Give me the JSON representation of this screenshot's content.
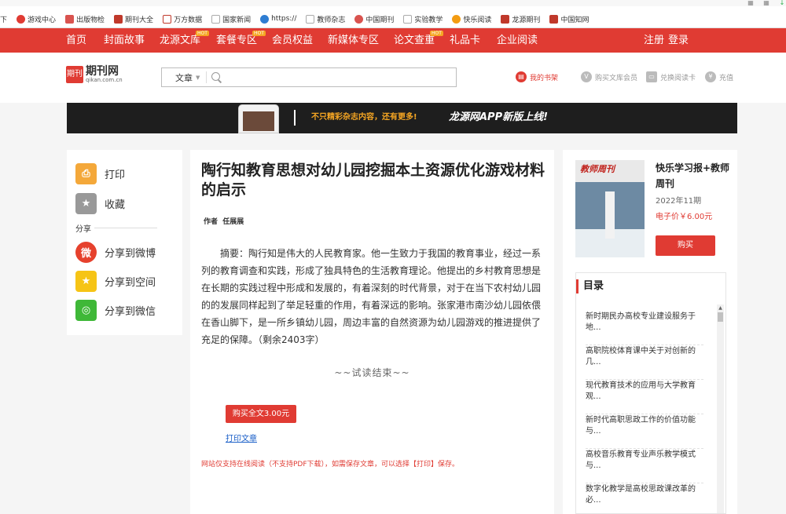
{
  "bookmarks": {
    "leading_text": "下",
    "items": [
      {
        "label": "游戏中心",
        "icon": "game-icon",
        "color": "#e03b33"
      },
      {
        "label": "出版物检",
        "icon": "pub-icon",
        "color": "#d9534f"
      },
      {
        "label": "期刊大全",
        "icon": "mag-icon",
        "color": "#c0392b"
      },
      {
        "label": "万方数据",
        "icon": "wanfang-icon",
        "color": "#c0392b"
      },
      {
        "label": "国家新闻",
        "icon": "doc-icon",
        "color": "#aaaaaa"
      },
      {
        "label": "https://",
        "icon": "globe-icon",
        "color": "#2e7dd2"
      },
      {
        "label": "教师杂志",
        "icon": "doc-icon",
        "color": "#aaaaaa"
      },
      {
        "label": "中国期刊",
        "icon": "cn-icon",
        "color": "#d9534f"
      },
      {
        "label": "实验教学",
        "icon": "doc-icon",
        "color": "#aaaaaa"
      },
      {
        "label": "快乐阅读",
        "icon": "happy-icon",
        "color": "#f39c12"
      },
      {
        "label": "龙源期刊",
        "icon": "longyuan-icon",
        "color": "#c0392b"
      },
      {
        "label": "中国知网",
        "icon": "cnki-icon",
        "color": "#c0392b"
      }
    ]
  },
  "nav": {
    "items": [
      {
        "label": "首页",
        "hot": false
      },
      {
        "label": "封面故事",
        "hot": false
      },
      {
        "label": "龙源文库",
        "hot": true
      },
      {
        "label": "套餐专区",
        "hot": true
      },
      {
        "label": "会员权益",
        "hot": false
      },
      {
        "label": "新媒体专区",
        "hot": false
      },
      {
        "label": "论文查重",
        "hot": true
      },
      {
        "label": "礼品卡",
        "hot": false
      },
      {
        "label": "企业阅读",
        "hot": false
      }
    ],
    "hot_badge": "HOT",
    "register": "注册",
    "login": "登录"
  },
  "header": {
    "logo_mark": "期刊",
    "logo_name": "期刊网",
    "logo_url": "qikan.com.cn",
    "search_category": "文章",
    "search_placeholder": "",
    "my_shelf": "我的书架",
    "buy_member": "购买文库会员",
    "exchange_card": "兑换阅读卡",
    "recharge": "充值"
  },
  "banner": {
    "text1": "不只精彩杂志内容，还有更多!",
    "text2": "龙源网APP新版上线!"
  },
  "share": {
    "print": "打印",
    "favorite": "收藏",
    "section": "分享",
    "weibo": "分享到微博",
    "qzone": "分享到空间",
    "wechat": "分享到微信"
  },
  "article": {
    "title": "陶行知教育思想对幼儿园挖掘本土资源优化游戏材料的启示",
    "author_label": "作者",
    "author": "任展展",
    "abstract": "摘要：陶行知是伟大的人民教育家。他一生致力于我国的教育事业，经过一系列的教育调查和实践，形成了独具特色的生活教育理论。他提出的乡村教育思想是在长期的实践过程中形成和发展的，有着深刻的时代背景，对于在当下农村幼儿园的的发展同样起到了举足轻重的作用，有着深远的影响。张家港市南沙幼儿园依偎在香山脚下，是一所乡镇幼儿园，周边丰富的自然资源为幼儿园游戏的推进提供了充足的保障。（剩余2403字）",
    "trial_end": "~~试读结束~~",
    "buy_full": "购买全文3.00元",
    "print_link": "打印文章",
    "notice": "网站仅支持在线阅读（不支持PDF下载），如需保存文章，可以选择【打印】保存。"
  },
  "magazine": {
    "cover_title": "教师周刊",
    "name": "快乐学习报+教师周刊",
    "issue": "2022年11期",
    "price": "电子价￥6.00元",
    "buy": "购买"
  },
  "toc": {
    "title": "目录",
    "items": [
      "新时期民办高校专业建设服务于地...",
      "高职院校体育课中关于对创新的几...",
      "现代教育技术的应用与大学教育观...",
      "新时代高职思政工作的价值功能与...",
      "高校音乐教育专业声乐教学模式与...",
      "数字化教学是高校思政课改革的必..."
    ]
  },
  "colors": {
    "brand_red": "#e03b33",
    "banner_orange": "#f6a623",
    "link_blue": "#1a5fc8"
  }
}
